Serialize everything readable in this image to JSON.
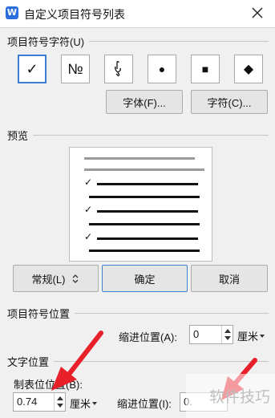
{
  "window": {
    "title": "自定义项目符号列表",
    "logo_glyph": "W",
    "logo_icon": "wps-writer-icon",
    "close_icon": "close-icon"
  },
  "symbol_section": {
    "header": "项目符号字符(U)",
    "bullets": [
      {
        "glyph": "✓",
        "icon": "checkmark-bullet",
        "selected": true
      },
      {
        "glyph": "№",
        "icon": "numero-sign-bullet",
        "selected": false
      },
      {
        "glyph": "ℽ",
        "icon": "hand-pointer-bullet",
        "selected": false
      },
      {
        "glyph": "●",
        "icon": "filled-circle-bullet",
        "selected": false
      },
      {
        "glyph": "■",
        "icon": "filled-square-bullet",
        "selected": false
      },
      {
        "glyph": "◆",
        "icon": "filled-diamond-bullet",
        "selected": false
      }
    ],
    "font_button": "字体(F)...",
    "char_button": "字符(C)..."
  },
  "preview_section": {
    "header": "预览",
    "bullet_glyph": "✓"
  },
  "actions": {
    "general_button": "常规(L)",
    "ok_button": "确定",
    "cancel_button": "取消"
  },
  "bullet_position": {
    "header": "项目符号位置",
    "indent_label": "缩进位置(A):",
    "indent_value": "0",
    "indent_unit": "厘米"
  },
  "text_position": {
    "header": "文字位置",
    "tab_label": "制表位位置(B):",
    "tab_value": "0.74",
    "tab_unit": "厘米",
    "indent_label": "缩进位置(I):",
    "indent_value": "0."
  },
  "watermark": {
    "text": "软件技巧"
  },
  "colors": {
    "accent": "#3c7fd4",
    "logo": "#2b6fde",
    "annotation": "#e8202a",
    "dialog_bg": "#f0f0f0"
  }
}
